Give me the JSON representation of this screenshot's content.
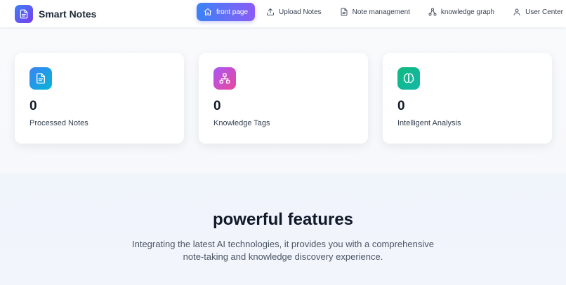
{
  "app": {
    "title": "Smart Notes"
  },
  "nav": {
    "items": [
      {
        "label": "front page",
        "icon": "home-icon",
        "active": true
      },
      {
        "label": "Upload Notes",
        "icon": "upload-icon",
        "active": false
      },
      {
        "label": "Note management",
        "icon": "document-icon",
        "active": false
      },
      {
        "label": "knowledge graph",
        "icon": "graph-icon",
        "active": false
      },
      {
        "label": "User Center",
        "icon": "user-icon",
        "active": false
      }
    ]
  },
  "stats": [
    {
      "value": "0",
      "label": "Processed Notes",
      "icon": "document-icon",
      "color": "#3b82f6"
    },
    {
      "value": "0",
      "label": "Knowledge Tags",
      "icon": "graph-icon",
      "color": "#a855f7"
    },
    {
      "value": "0",
      "label": "Intelligent Analysis",
      "icon": "brain-icon",
      "color": "#10b981"
    }
  ],
  "features": {
    "title": "powerful features",
    "description": "Integrating the latest AI technologies, it provides you with a comprehensive note-taking and knowledge discovery experience."
  },
  "colors": {
    "accent_start": "#3b82f6",
    "accent_end": "#8b5cf6",
    "text_primary": "#111827",
    "text_secondary": "#4b5563"
  }
}
